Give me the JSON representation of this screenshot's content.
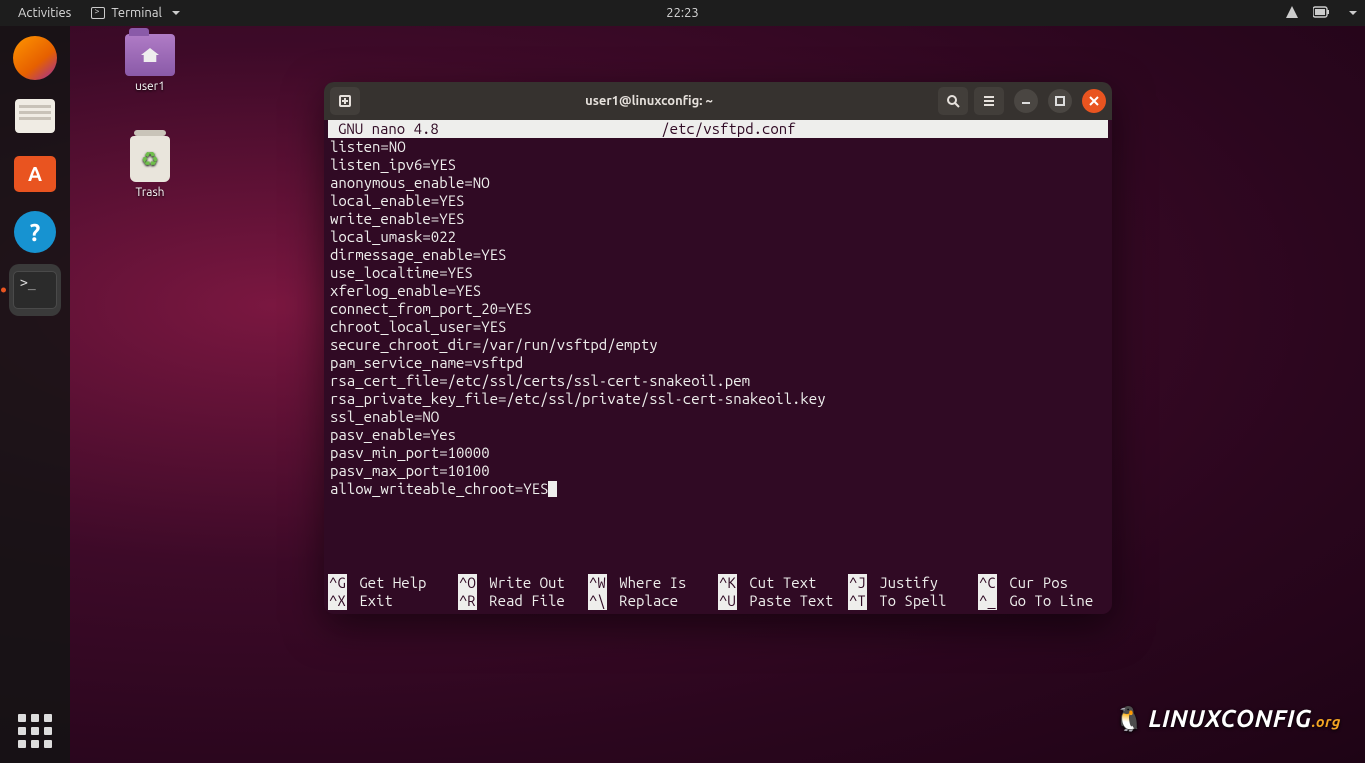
{
  "top_panel": {
    "activities": "Activities",
    "app_menu": "Terminal",
    "clock": "22:23"
  },
  "desktop_icons": {
    "home": "user1",
    "trash": "Trash"
  },
  "window": {
    "title": "user1@linuxconfig: ~"
  },
  "nano": {
    "app": "GNU nano 4.8",
    "file": "/etc/vsftpd.conf",
    "lines": [
      "listen=NO",
      "listen_ipv6=YES",
      "anonymous_enable=NO",
      "local_enable=YES",
      "write_enable=YES",
      "local_umask=022",
      "dirmessage_enable=YES",
      "use_localtime=YES",
      "xferlog_enable=YES",
      "connect_from_port_20=YES",
      "chroot_local_user=YES",
      "secure_chroot_dir=/var/run/vsftpd/empty",
      "pam_service_name=vsftpd",
      "rsa_cert_file=/etc/ssl/certs/ssl-cert-snakeoil.pem",
      "rsa_private_key_file=/etc/ssl/private/ssl-cert-snakeoil.key",
      "ssl_enable=NO",
      "pasv_enable=Yes",
      "pasv_min_port=10000",
      "pasv_max_port=10100",
      "allow_writeable_chroot=YES"
    ],
    "footer": [
      [
        {
          "k": "^G",
          "l": "Get Help"
        },
        {
          "k": "^O",
          "l": "Write Out"
        },
        {
          "k": "^W",
          "l": "Where Is"
        },
        {
          "k": "^K",
          "l": "Cut Text"
        },
        {
          "k": "^J",
          "l": "Justify"
        },
        {
          "k": "^C",
          "l": "Cur Pos"
        }
      ],
      [
        {
          "k": "^X",
          "l": "Exit"
        },
        {
          "k": "^R",
          "l": "Read File"
        },
        {
          "k": "^\\",
          "l": "Replace"
        },
        {
          "k": "^U",
          "l": "Paste Text"
        },
        {
          "k": "^T",
          "l": "To Spell"
        },
        {
          "k": "^_",
          "l": "Go To Line"
        }
      ]
    ]
  },
  "watermark": "LINUXCONFIG"
}
